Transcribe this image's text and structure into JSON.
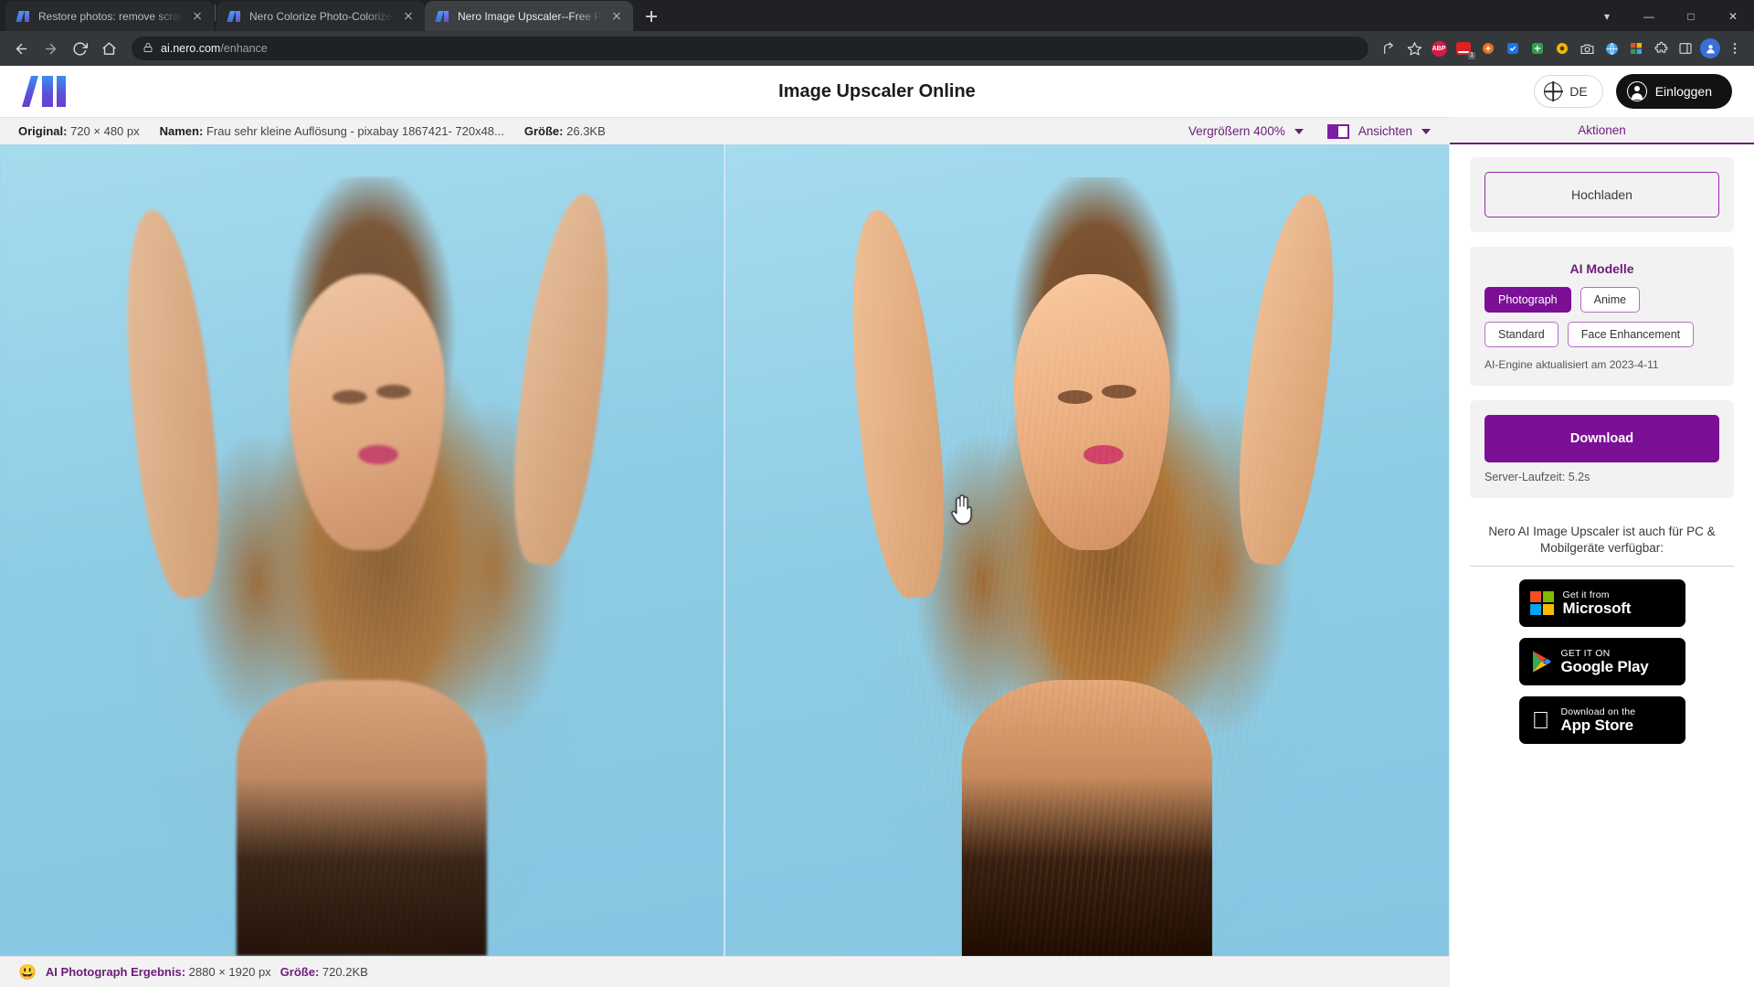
{
  "browser": {
    "tabs": [
      {
        "title": "Restore photos: remove scratche",
        "active": false,
        "favicon": "nero-ai-icon"
      },
      {
        "title": "Nero Colorize Photo-Colorize Yo",
        "active": false,
        "favicon": "nero-ai-icon"
      },
      {
        "title": "Nero Image Upscaler--Free Photo",
        "active": true,
        "favicon": "nero-ai-icon"
      }
    ],
    "new_tab_label": "+",
    "window_controls": {
      "minimize": "–",
      "maximize": "☐",
      "close": "✕",
      "search": "⌵"
    },
    "nav": {
      "back": "←",
      "forward": "→",
      "reload": "⟳",
      "home": "⌂"
    },
    "omnibox": {
      "lock": "lock-icon",
      "domain": "ai.nero.com",
      "path": "/enhance"
    },
    "toolbar_icons": [
      "share-icon",
      "bookmark-star-icon",
      "abp-extension-icon",
      "red-extension-icon",
      "orange-extension-icon",
      "blue-extension-icon",
      "green-extension-icon",
      "yellow-extension-icon",
      "camera-extension-icon",
      "globe-extension-icon",
      "grid-extension-icon",
      "puzzle-extension-icon",
      "sidepanel-icon",
      "profile-avatar",
      "chrome-menu-icon"
    ],
    "abp_label": "ABP",
    "badge_count": "1"
  },
  "header": {
    "logo_alt": "AI",
    "title": "Image Upscaler Online",
    "language": "DE",
    "login": "Einloggen"
  },
  "infobar": {
    "original_label": "Original:",
    "original_value": "720 × 480 px",
    "name_label": "Namen:",
    "name_value": "Frau sehr kleine Auflösung - pixabay 1867421- 720x48...",
    "size_label": "Größe:",
    "size_value": "26.3KB",
    "zoom_label": "Vergrößern 400%",
    "views_label": "Ansichten"
  },
  "statusbar": {
    "emoji": "😃",
    "result_label": "AI Photograph Ergebnis:",
    "result_value": "2880 × 1920 px",
    "size_label": "Größe:",
    "size_value": "720.2KB"
  },
  "sidebar": {
    "tab_label": "Aktionen",
    "upload_label": "Hochladen",
    "models_title": "AI Modelle",
    "models": [
      {
        "label": "Photograph",
        "selected": true
      },
      {
        "label": "Anime",
        "selected": false
      },
      {
        "label": "Standard",
        "selected": false
      },
      {
        "label": "Face Enhancement",
        "selected": false
      }
    ],
    "engine_note": "AI-Engine aktualisiert am 2023-4-11",
    "download_label": "Download",
    "runtime": "Server-Laufzeit: 5.2s",
    "promo_text": "Nero AI Image Upscaler ist auch für PC & Mobilgeräte verfügbar:",
    "stores": [
      {
        "small": "Get it from",
        "big": "Microsoft",
        "icon": "microsoft-logo"
      },
      {
        "small": "GET IT ON",
        "big": "Google Play",
        "icon": "google-play-logo"
      },
      {
        "small": "Download on the",
        "big": "App Store",
        "icon": "apple-logo"
      }
    ]
  },
  "colors": {
    "accent_purple": "#7b0f96",
    "header_purple": "#6d1b7b",
    "chrome_dark": "#35383b"
  }
}
